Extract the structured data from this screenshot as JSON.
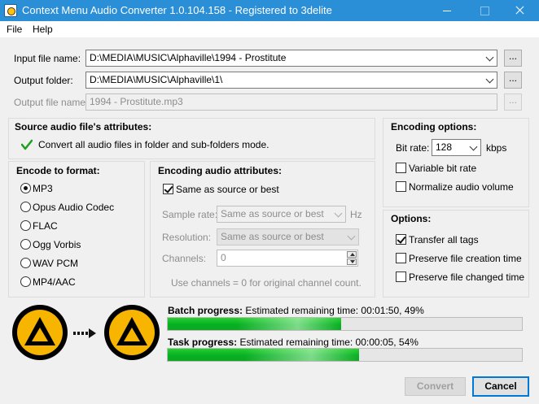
{
  "window": {
    "title": "Context Menu Audio Converter 1.0.104.158 - Registered to 3delite"
  },
  "menu": {
    "file": "File",
    "help": "Help"
  },
  "files": {
    "input_label": "Input file name:",
    "input_value": "D:\\MEDIA\\MUSIC\\Alphaville\\1994 - Prostitute",
    "output_folder_label": "Output folder:",
    "output_folder_value": "D:\\MEDIA\\MUSIC\\Alphaville\\1\\",
    "output_file_label": "Output file name:",
    "output_file_value": "1994 - Prostitute.mp3",
    "browse_label": "..."
  },
  "source": {
    "title": "Source audio file's attributes:",
    "message": "Convert all audio files in folder and sub-folders mode."
  },
  "encode_format": {
    "title": "Encode to format:",
    "options": [
      "MP3",
      "Opus Audio Codec",
      "FLAC",
      "Ogg Vorbis",
      "WAV PCM",
      "MP4/AAC"
    ],
    "selected": "MP3"
  },
  "attributes": {
    "title": "Encoding audio attributes:",
    "same_as_source_label": "Same as source or best",
    "same_as_source_checked": true,
    "sample_rate_label": "Sample rate:",
    "sample_rate_value": "Same as source or best",
    "sample_rate_unit": "Hz",
    "resolution_label": "Resolution:",
    "resolution_value": "Same as source or best",
    "channels_label": "Channels:",
    "channels_value": "0",
    "hint": "Use channels = 0 for original channel count."
  },
  "encoding_options": {
    "title": "Encoding options:",
    "bitrate_label": "Bit rate:",
    "bitrate_value": "128",
    "bitrate_unit": "kbps",
    "vbr_label": "Variable bit rate",
    "vbr_checked": false,
    "normalize_label": "Normalize audio volume",
    "normalize_checked": false
  },
  "options": {
    "title": "Options:",
    "transfer_tags_label": "Transfer all tags",
    "transfer_tags_checked": true,
    "creation_time_label": "Preserve file creation time",
    "creation_time_checked": false,
    "changed_time_label": "Preserve file changed time",
    "changed_time_checked": false
  },
  "progress": {
    "batch_label": "Batch progress:",
    "batch_status": "Estimated remaining time: 00:01:50, 49%",
    "batch_percent": 49,
    "task_label": "Task progress:",
    "task_status": "Estimated remaining time: 00:00:05, 54%",
    "task_percent": 54
  },
  "buttons": {
    "convert": "Convert",
    "cancel": "Cancel"
  },
  "icons": {
    "app": "app-icon",
    "source_logo": "aimp-logo-icon",
    "arrow": "arrow-right-icon",
    "target_logo": "aimp-logo-icon",
    "check": "checkmark-icon"
  },
  "colors": {
    "titlebar": "#2b8fd8",
    "progress": "#06b025",
    "logo": "#f7b500"
  }
}
